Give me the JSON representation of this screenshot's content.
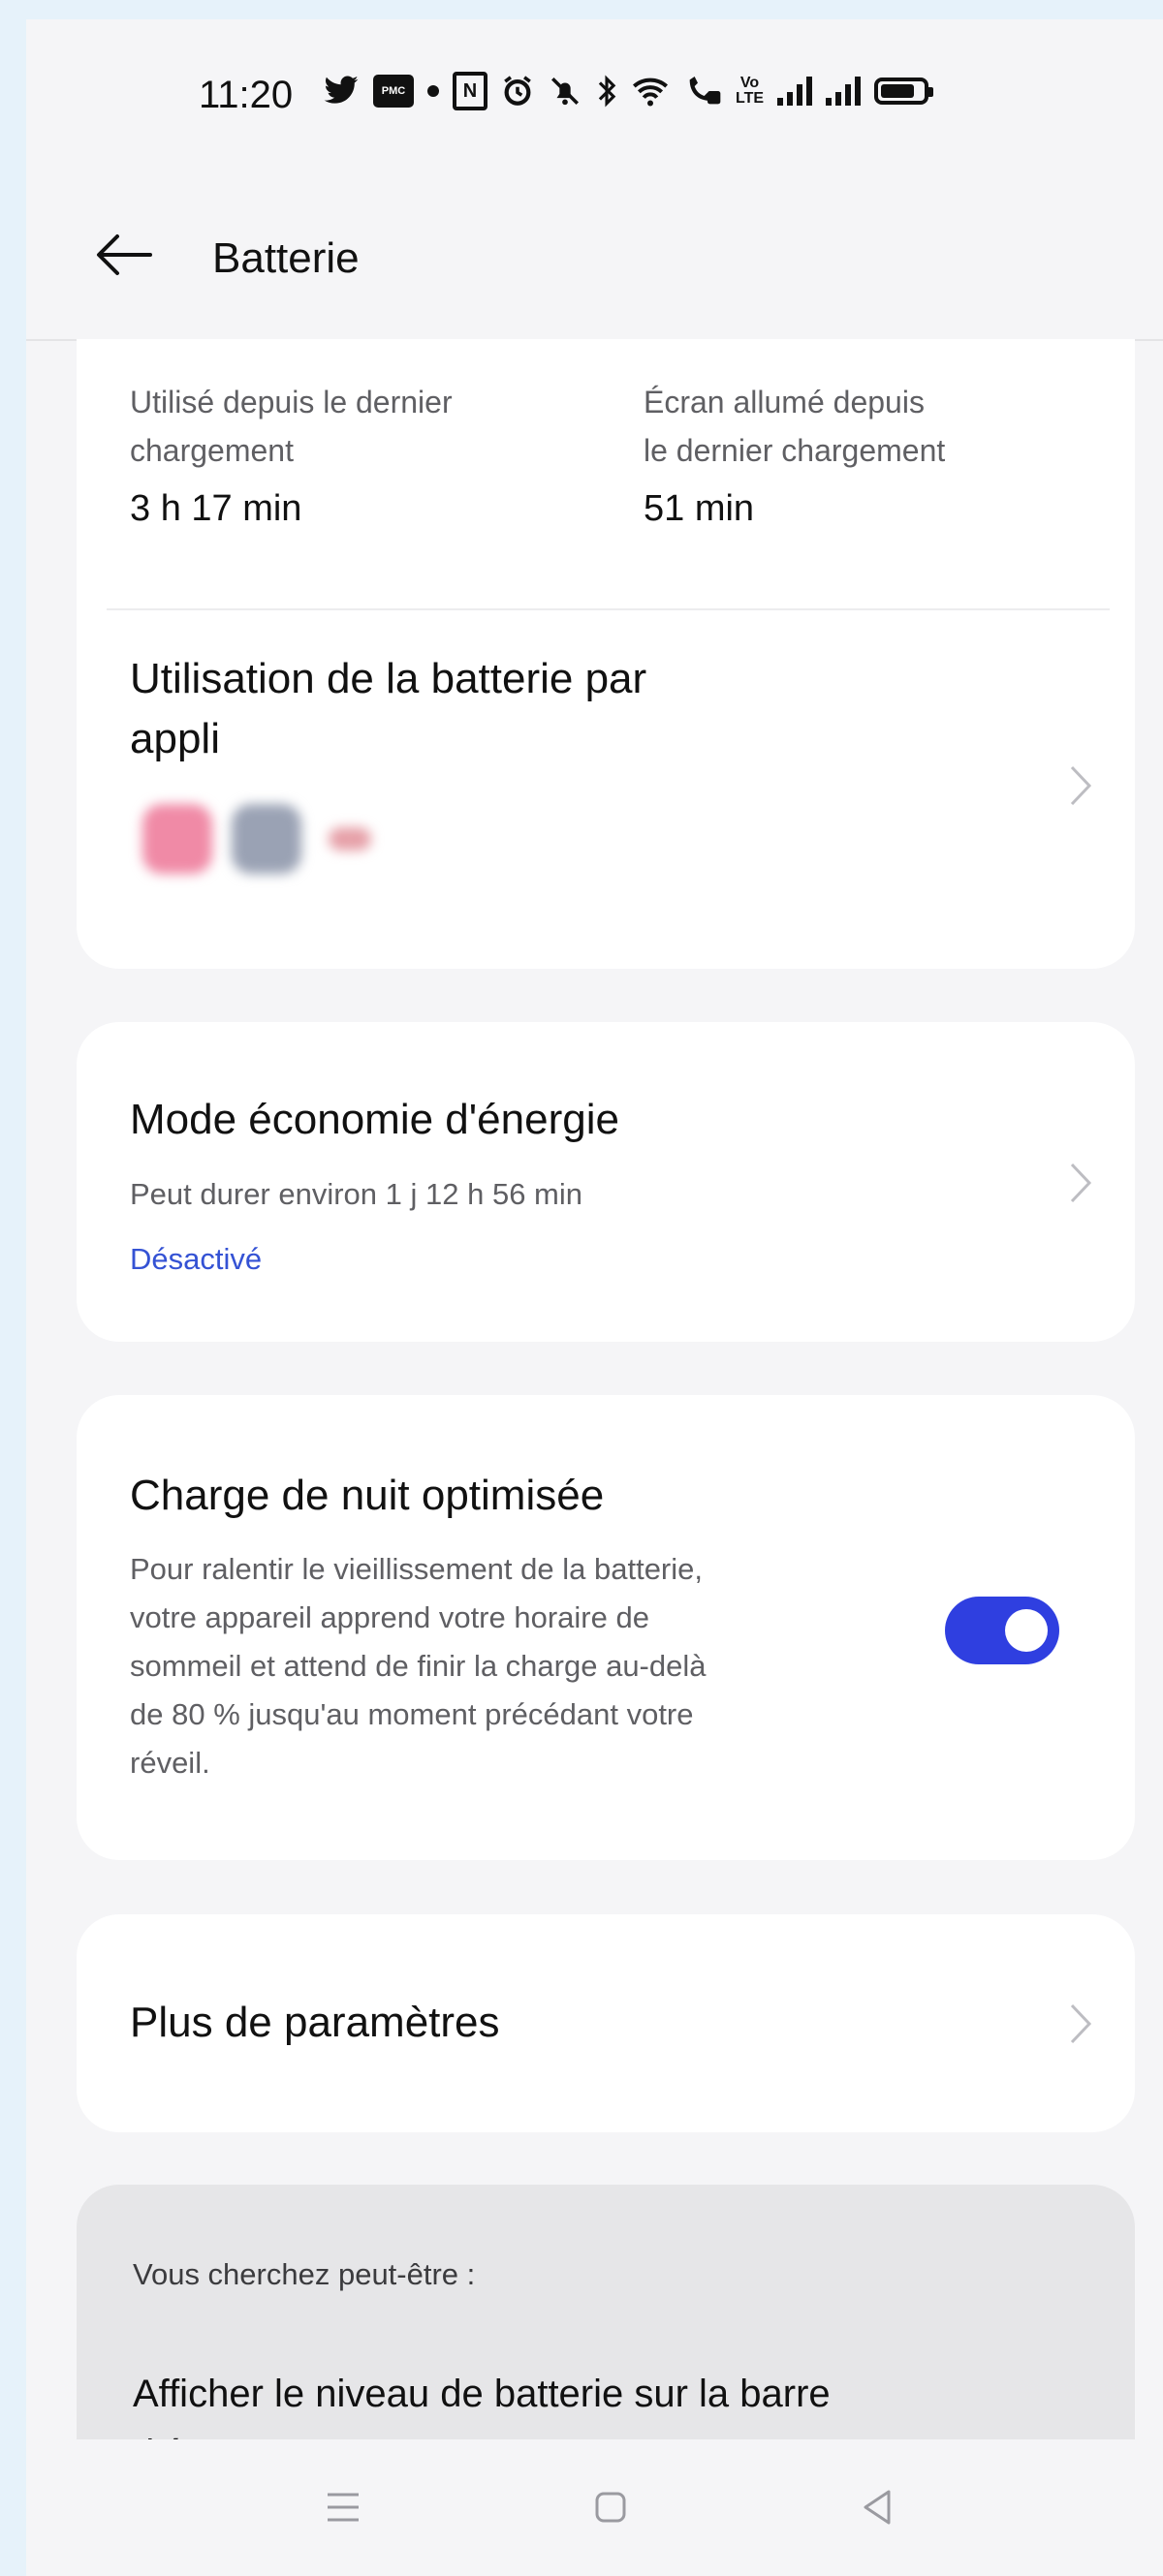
{
  "status_bar": {
    "time": "11:20",
    "icons": [
      "twitter-icon",
      "message-icon",
      "dot-icon",
      "nfc-icon",
      "alarm-icon",
      "mute-icon",
      "bluetooth-icon",
      "wifi-icon",
      "wifi-calling-icon",
      "volte-icon",
      "signal-icon",
      "signal-icon",
      "battery-icon"
    ]
  },
  "header": {
    "title": "Batterie"
  },
  "usage": {
    "used_label": "Utilisé depuis le dernier chargement",
    "used_label_line1": "Utilisé depuis le dernier",
    "used_label_line2": "chargement",
    "used_value": "3 h 17 min",
    "screen_label_line1": "Écran allumé depuis",
    "screen_label_line2": "le dernier chargement",
    "screen_value": "51 min"
  },
  "app_usage": {
    "title_line1": "Utilisation de la batterie par",
    "title_line2": "appli"
  },
  "power_saving": {
    "title": "Mode économie d'énergie",
    "subtitle": "Peut durer environ 1 j 12 h 56 min",
    "status": "Désactivé"
  },
  "night_charge": {
    "title": "Charge de nuit optimisée",
    "description_lines": [
      "Pour ralentir le vieillissement de la batterie,",
      "votre appareil apprend votre horaire de",
      "sommeil et attend de finir la charge au-delà",
      "de 80 % jusqu'au moment précédant votre",
      "réveil."
    ],
    "enabled": true
  },
  "more_settings": {
    "title": "Plus de paramètres"
  },
  "suggestions": {
    "label": "Vous cherchez peut-être :",
    "item_line1": "Afficher le niveau de batterie sur la barre",
    "item_line2": "d'état"
  },
  "colors": {
    "accent": "#2f3fe0",
    "link": "#3452d4",
    "background": "#f5f5f7",
    "card": "#ffffff",
    "outer": "#e6f2fa"
  }
}
